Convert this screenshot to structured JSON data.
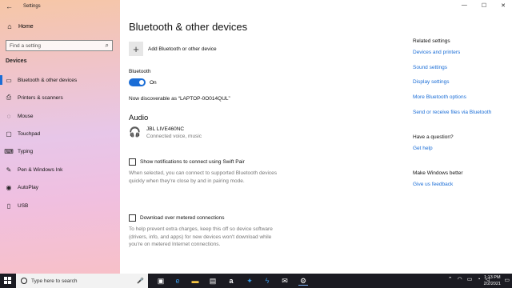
{
  "window": {
    "title": "Settings",
    "controls": {
      "minimize": "—",
      "maximize": "☐",
      "close": "✕"
    }
  },
  "sidebar": {
    "home_label": "Home",
    "search_placeholder": "Find a setting",
    "section_title": "Devices",
    "items": [
      {
        "label": "Bluetooth & other devices",
        "icon": "bluetooth-icon",
        "glyph": "▭",
        "active": true
      },
      {
        "label": "Printers & scanners",
        "icon": "printer-icon",
        "glyph": "⎙",
        "active": false
      },
      {
        "label": "Mouse",
        "icon": "mouse-icon",
        "glyph": "◌",
        "active": false
      },
      {
        "label": "Touchpad",
        "icon": "touchpad-icon",
        "glyph": "▢",
        "active": false
      },
      {
        "label": "Typing",
        "icon": "keyboard-icon",
        "glyph": "⌨",
        "active": false
      },
      {
        "label": "Pen & Windows Ink",
        "icon": "pen-icon",
        "glyph": "✎",
        "active": false
      },
      {
        "label": "AutoPlay",
        "icon": "autoplay-icon",
        "glyph": "◉",
        "active": false
      },
      {
        "label": "USB",
        "icon": "usb-icon",
        "glyph": "▯",
        "active": false
      }
    ]
  },
  "main": {
    "title": "Bluetooth & other devices",
    "add_device_label": "Add Bluetooth or other device",
    "bluetooth_heading": "Bluetooth",
    "bluetooth_state": "On",
    "discoverable_text": "Now discoverable as “LAPTOP-0O014QUL”",
    "audio_heading": "Audio",
    "audio_device": {
      "name": "JBL LIVE460NC",
      "status": "Connected voice, music"
    },
    "swift_pair": {
      "label": "Show notifications to connect using Swift Pair",
      "desc_line1": "When selected, you can connect to supported Bluetooth devices",
      "desc_line2": "quickly when they're close by and in pairing mode."
    },
    "metered": {
      "label": "Download over metered connections",
      "desc_line1": "To help prevent extra charges, keep this off so device software",
      "desc_line2": "(drivers, info, and apps) for new devices won't download while",
      "desc_line3": "you're on metered Internet connections."
    }
  },
  "related": {
    "heading": "Related settings",
    "links": [
      "Devices and printers",
      "Sound settings",
      "Display settings",
      "More Bluetooth options",
      "Send or receive files via Bluetooth"
    ],
    "question_heading": "Have a question?",
    "help_link": "Get help",
    "better_heading": "Make Windows better",
    "feedback_link": "Give us feedback"
  },
  "taskbar": {
    "search_placeholder": "Type here to search",
    "time": "1:13 PM",
    "date": "2/2/2021"
  }
}
